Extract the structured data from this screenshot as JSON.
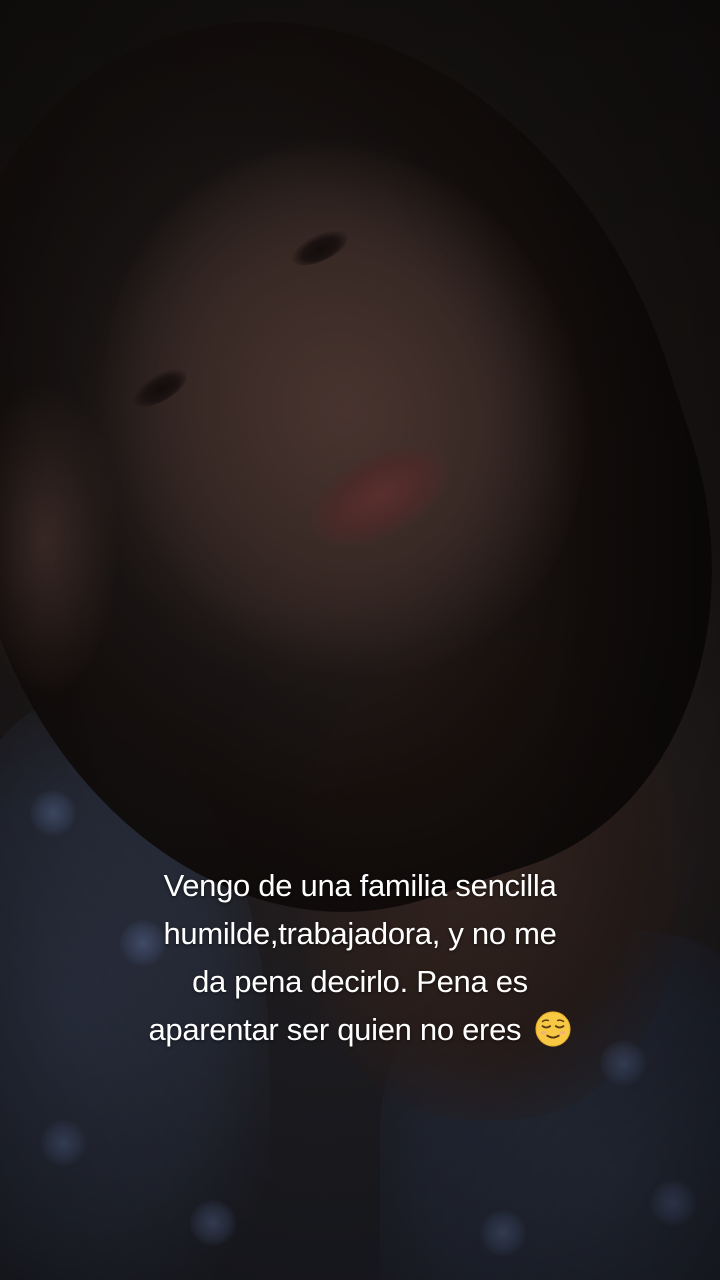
{
  "caption": {
    "lines": [
      "Vengo de una familia sencilla",
      "humilde,trabajadora, y no me",
      "da pena decirlo. Pena es",
      "aparentar ser quien no eres"
    ],
    "emoji": "relieved-face-emoji"
  },
  "colors": {
    "text": "#ffffff",
    "emoji_face": "#f7c843",
    "background": "#0b0908"
  }
}
